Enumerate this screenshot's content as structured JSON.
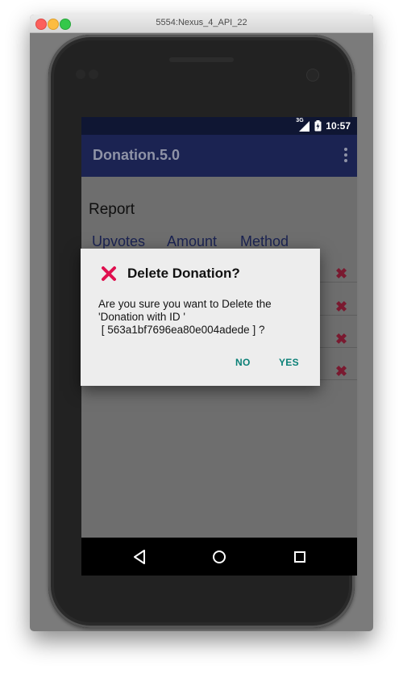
{
  "window": {
    "title": "5554:Nexus_4_API_22"
  },
  "status_bar": {
    "network": "3G",
    "time": "10:57",
    "icons": [
      "signal-icon",
      "battery-icon"
    ]
  },
  "app_bar": {
    "title": "Donation.5.0",
    "menu_icon": "overflow-menu-icon"
  },
  "report": {
    "title": "Report",
    "columns": [
      "Upvotes",
      "Amount",
      "Method"
    ],
    "row_count": 4,
    "row_delete_icon": "delete-x-icon"
  },
  "dialog": {
    "icon": "delete-x-icon",
    "title": "Delete Donation?",
    "message_lines": [
      "Are you sure you want to Delete the",
      "'Donation with ID '",
      " [ 563a1bf7696ea80e004adede ] ?"
    ],
    "negative_label": "NO",
    "positive_label": "YES"
  },
  "nav_bar": {
    "icons": [
      "back-icon",
      "home-icon",
      "recents-icon"
    ]
  },
  "colors": {
    "status_bar": "#0f1633",
    "app_bar": "#1b2352",
    "accent": "#0b8077",
    "delete_icon": "#e0104f"
  }
}
